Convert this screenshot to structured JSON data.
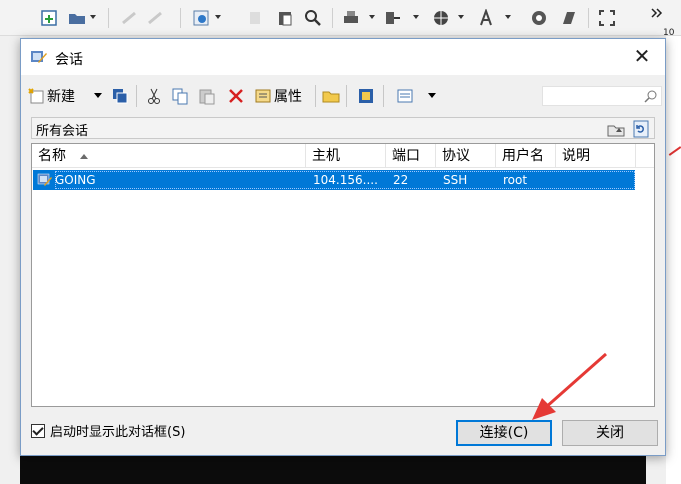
{
  "dialog": {
    "title": "会话",
    "toolbar": {
      "new_label": "新建",
      "properties_label": "属性",
      "search_placeholder": ""
    },
    "folder_label": "所有会话",
    "columns": [
      "名称",
      "主机",
      "端口",
      "协议",
      "用户名",
      "说明"
    ],
    "sessions": [
      {
        "name": "GOING",
        "host": "104.156....",
        "port": "22",
        "protocol": "SSH",
        "user": "root",
        "desc": ""
      }
    ],
    "show_on_startup_label": "启动时显示此对话框(S)",
    "show_on_startup_checked": true,
    "connect_label": "连接(C)",
    "close_label": "关闭"
  },
  "background": {
    "right_number": "10"
  },
  "colors": {
    "selection": "#0078d7",
    "annotation_arrow": "#e53935"
  }
}
